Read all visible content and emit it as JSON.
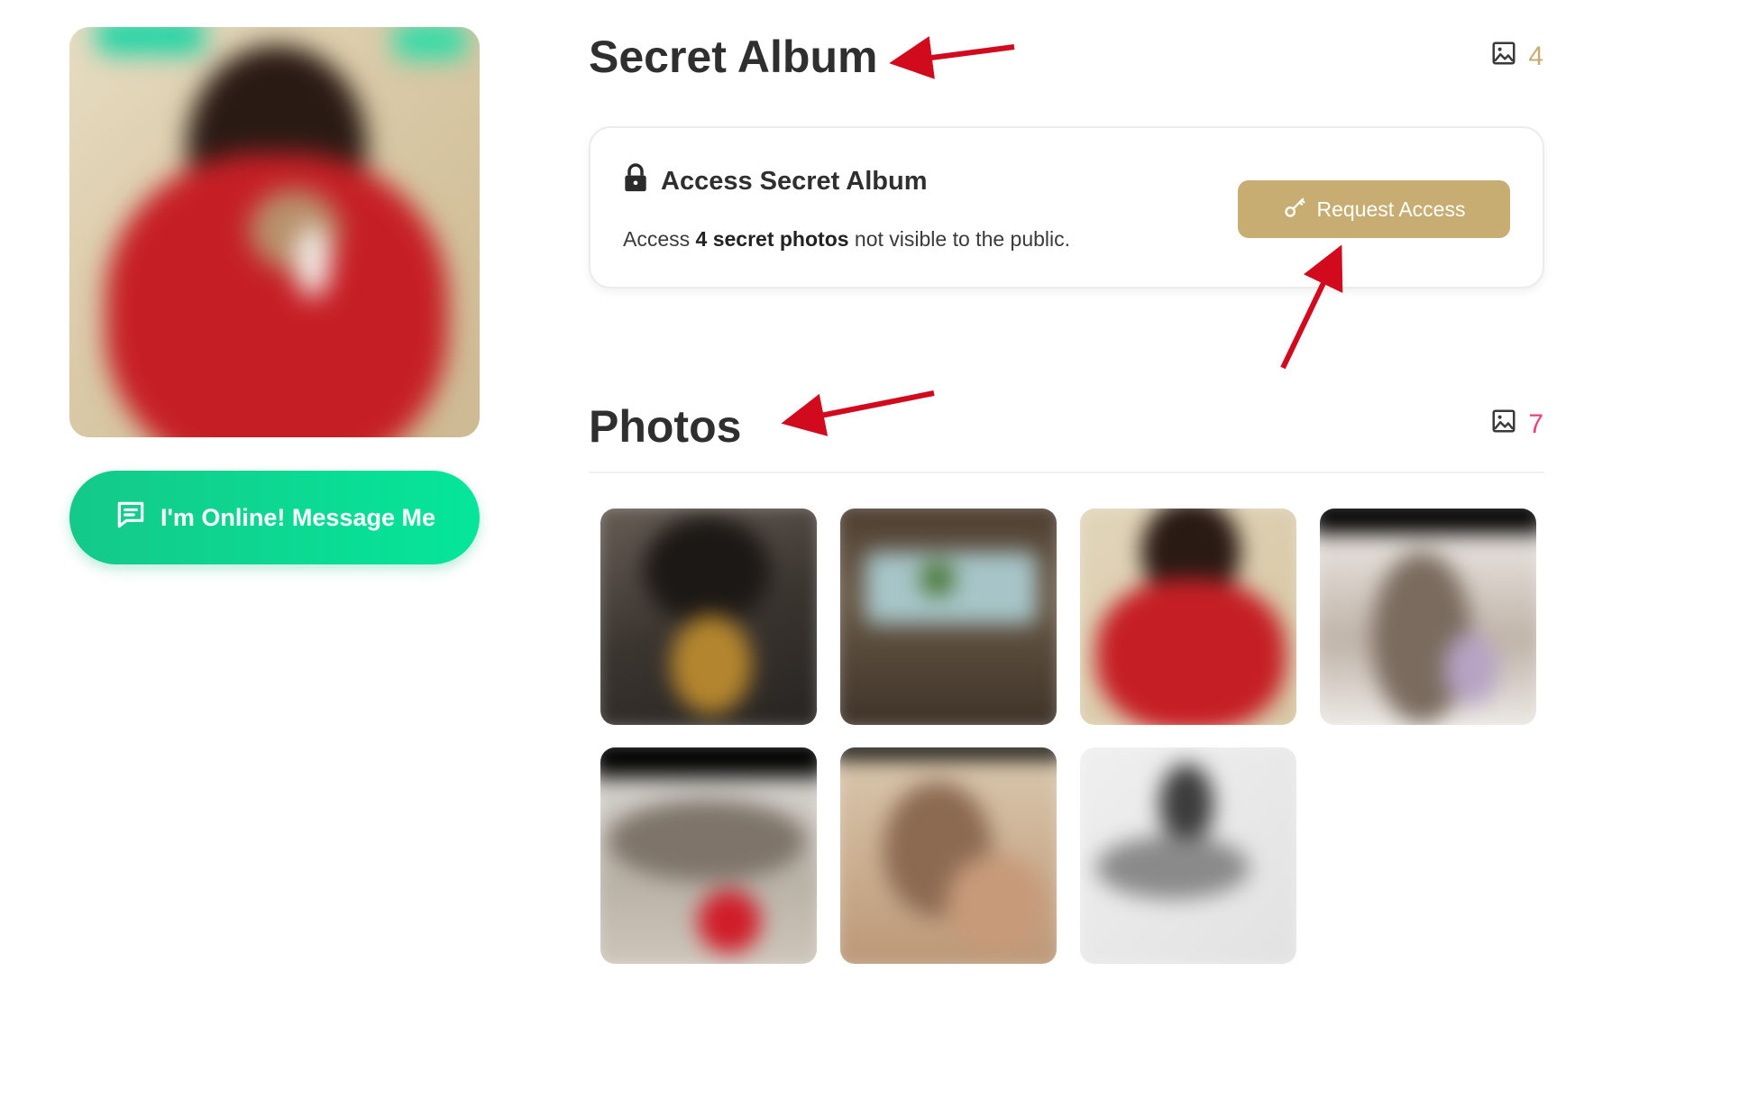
{
  "profile": {
    "message_button_label": "I'm Online! Message Me"
  },
  "secret_album": {
    "title": "Secret Album",
    "count": "4",
    "card_heading": "Access Secret Album",
    "desc_prefix": "Access ",
    "desc_count": "4",
    "desc_bold": "secret photos",
    "desc_suffix": " not visible to the public.",
    "request_button_label": "Request Access",
    "count_color": "#c8ad72"
  },
  "photos": {
    "title": "Photos",
    "count": "7",
    "count_color": "#e8417e"
  },
  "colors": {
    "accent_green": "#0bd890",
    "gold": "#c8ad72",
    "annotation_arrow": "#d20a1e"
  }
}
